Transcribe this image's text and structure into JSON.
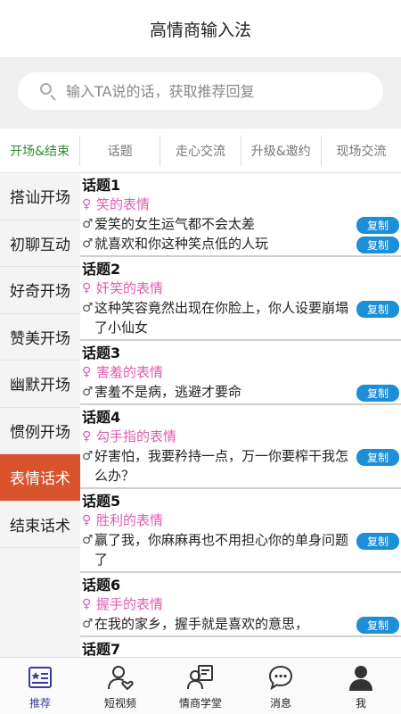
{
  "app": {
    "title": "高情商输入法"
  },
  "search": {
    "placeholder": "输入TA说的话，获取推荐回复"
  },
  "tabs": [
    {
      "label": "开场&结束",
      "active": true
    },
    {
      "label": "话题",
      "active": false
    },
    {
      "label": "走心交流",
      "active": false
    },
    {
      "label": "升级&邀约",
      "active": false
    },
    {
      "label": "现场交流",
      "active": false
    }
  ],
  "sidebar": [
    {
      "label": "搭讪开场"
    },
    {
      "label": "初聊互动"
    },
    {
      "label": "好奇开场"
    },
    {
      "label": "赞美开场"
    },
    {
      "label": "幽默开场"
    },
    {
      "label": "惯例开场"
    },
    {
      "label": "表情话术"
    },
    {
      "label": "结束话术"
    }
  ],
  "copy_label": "复制",
  "topics": [
    {
      "title": "话题1",
      "emotion": "笑的表情",
      "replies": [
        "爱笑的女生运气都不会太差",
        "就喜欢和你这种笑点低的人玩"
      ]
    },
    {
      "title": "话题2",
      "emotion": "奸笑的表情",
      "replies": [
        "这种笑容竟然出现在你脸上，你人设要崩塌了小仙女"
      ]
    },
    {
      "title": "话题3",
      "emotion": "害羞的表情",
      "replies": [
        "害羞不是病，逃避才要命"
      ]
    },
    {
      "title": "话题4",
      "emotion": "勾手指的表情",
      "replies": [
        "好害怕，我要矜持一点，万一你要榨干我怎么办？"
      ]
    },
    {
      "title": "话题5",
      "emotion": "胜利的表情",
      "replies": [
        "赢了我，你麻麻再也不用担心你的单身问题了"
      ]
    },
    {
      "title": "话题6",
      "emotion": "握手的表情",
      "replies": [
        "在我的家乡，握手就是喜欢的意思，"
      ]
    },
    {
      "title": "话题7",
      "emotion": "",
      "replies": []
    }
  ],
  "bottom_nav": [
    {
      "label": "推荐",
      "icon": "list-star-icon",
      "active": true
    },
    {
      "label": "短视频",
      "icon": "user-heart-icon",
      "active": false
    },
    {
      "label": "情商学堂",
      "icon": "user-board-icon",
      "active": false
    },
    {
      "label": "消息",
      "icon": "chat-bubble-icon",
      "active": false
    },
    {
      "label": "我",
      "icon": "user-icon",
      "active": false
    }
  ],
  "colors": {
    "accent_active_tab": "#2e8b2e",
    "sidebar_active": "#d9532c",
    "copy_button": "#1c8fd6",
    "emotion_pink": "#e05cb0",
    "nav_active": "#3b3b9a"
  }
}
